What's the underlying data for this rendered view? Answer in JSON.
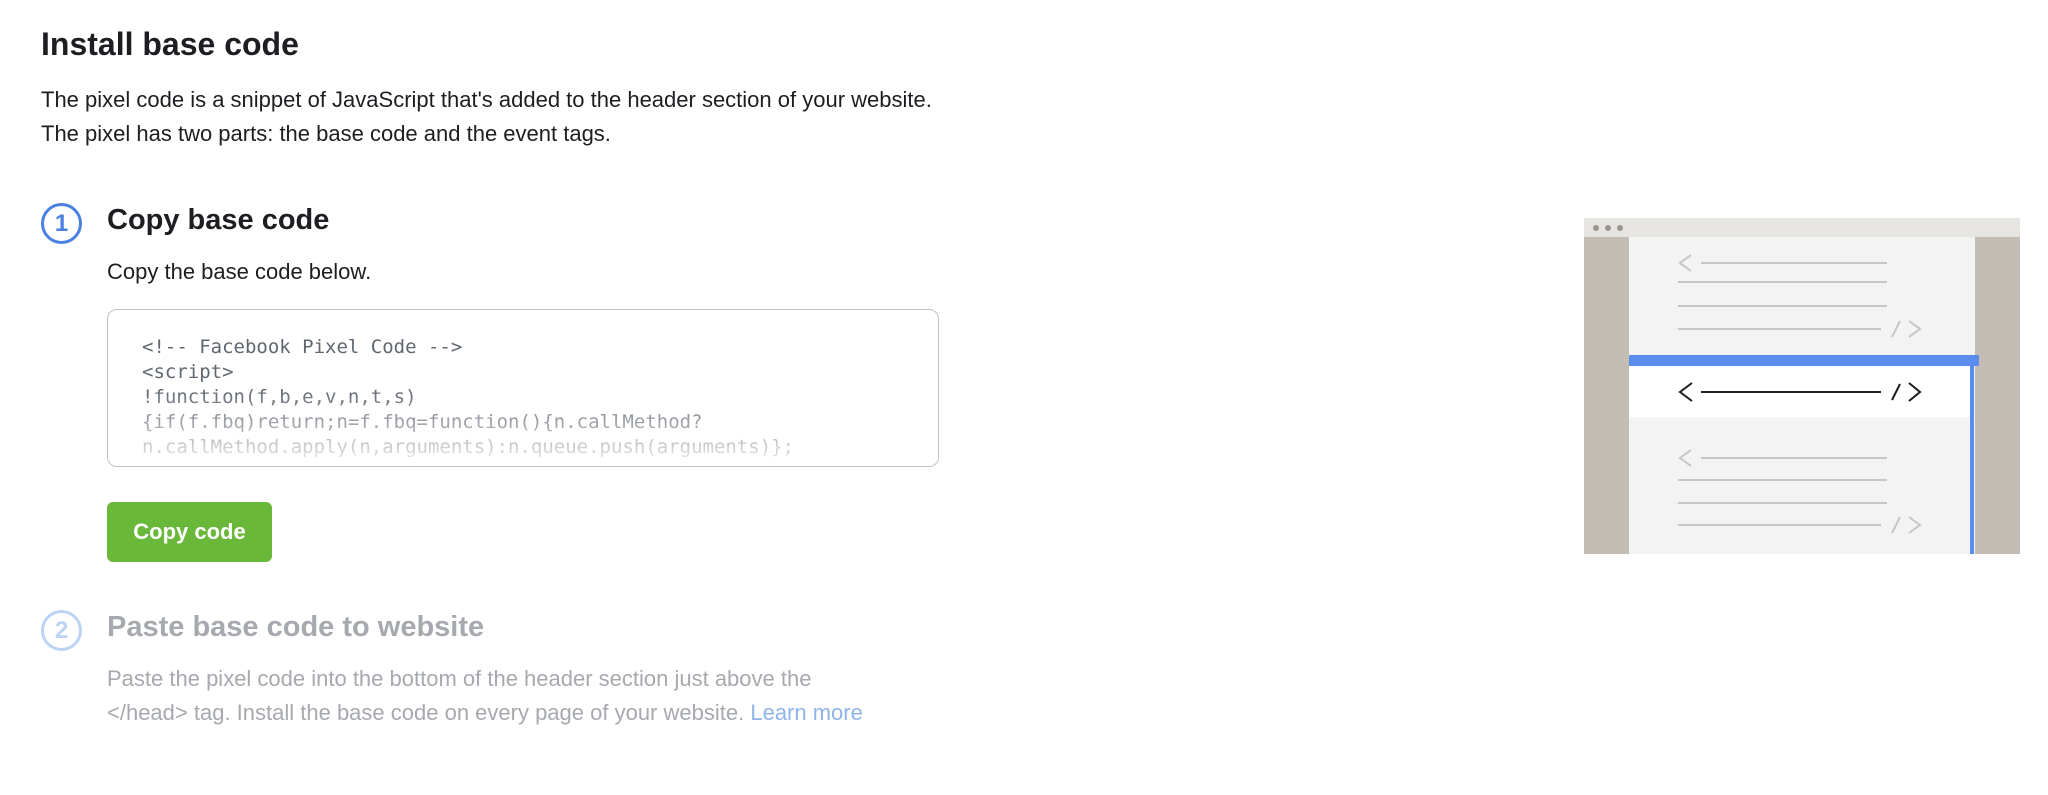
{
  "header": {
    "title": "Install base code",
    "intro_line1": "The pixel code is a snippet of JavaScript that's added to the header section of your website.",
    "intro_line2": "The pixel has two parts: the base code and the event tags."
  },
  "step1": {
    "number": "1",
    "title": "Copy base code",
    "description": "Copy the base code below.",
    "code": "<!-- Facebook Pixel Code -->\n<script>\n!function(f,b,e,v,n,t,s)\n{if(f.fbq)return;n=f.fbq=function(){n.callMethod?\nn.callMethod.apply(n,arguments):n.queue.push(arguments)};",
    "button_label": "Copy code"
  },
  "step2": {
    "number": "2",
    "title": "Paste base code to website",
    "description_line1": "Paste the pixel code into the bottom of the header section just above the",
    "description_line2": "</head> tag. Install the base code on every page of your website.",
    "learn_more": "Learn more"
  },
  "illustration": {
    "icon": "browser-code-illustration",
    "highlight_color": "#5b8def",
    "frame_color": "#c3bdb6"
  },
  "colors": {
    "accent": "#4a80e0",
    "button": "#69b83a",
    "muted_text": "#a6a9ae",
    "link": "#8fb4ea"
  }
}
